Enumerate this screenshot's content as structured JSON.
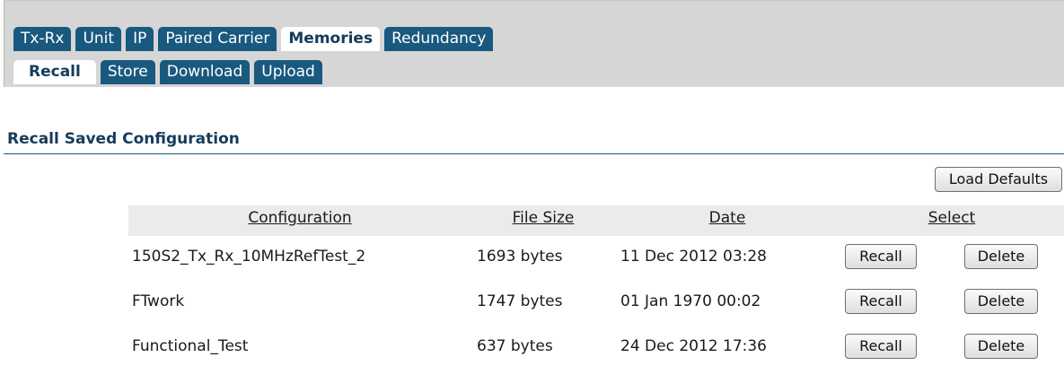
{
  "tabs": {
    "main": [
      "Tx-Rx",
      "Unit",
      "IP",
      "Paired Carrier",
      "Memories",
      "Redundancy"
    ],
    "main_active": "Memories",
    "sub": [
      "Recall",
      "Store",
      "Download",
      "Upload"
    ],
    "sub_active": "Recall"
  },
  "section": {
    "title": "Recall Saved Configuration"
  },
  "load_defaults_label": "Load Defaults",
  "table": {
    "headers": {
      "configuration": "Configuration",
      "file_size": "File Size",
      "date": "Date",
      "select": "Select"
    },
    "rows": [
      {
        "name": "150S2_Tx_Rx_10MHzRefTest_2",
        "size": "1693 bytes",
        "date": "11 Dec 2012 03:28",
        "recall": "Recall",
        "delete": "Delete"
      },
      {
        "name": "FTwork",
        "size": "1747 bytes",
        "date": "01 Jan 1970 00:02",
        "recall": "Recall",
        "delete": "Delete"
      },
      {
        "name": "Functional_Test",
        "size": "637 bytes",
        "date": "24 Dec 2012 17:36",
        "recall": "Recall",
        "delete": "Delete"
      }
    ]
  }
}
